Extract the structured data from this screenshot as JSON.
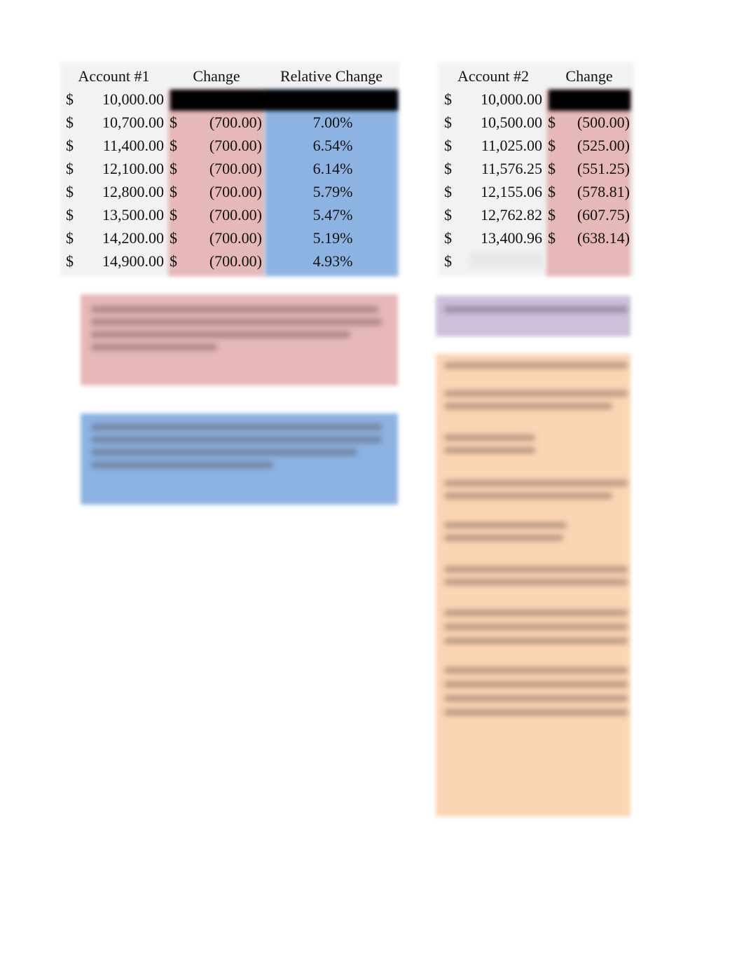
{
  "table1": {
    "headers": [
      "Account #1",
      "Change",
      "Relative Change"
    ],
    "rows": [
      {
        "currency": "$",
        "balance": "10,000.00",
        "change_currency": "",
        "change": "",
        "relative": ""
      },
      {
        "currency": "$",
        "balance": "10,700.00",
        "change_currency": "$",
        "change": "(700.00)",
        "relative": "7.00%"
      },
      {
        "currency": "$",
        "balance": "11,400.00",
        "change_currency": "$",
        "change": "(700.00)",
        "relative": "6.54%"
      },
      {
        "currency": "$",
        "balance": "12,100.00",
        "change_currency": "$",
        "change": "(700.00)",
        "relative": "6.14%"
      },
      {
        "currency": "$",
        "balance": "12,800.00",
        "change_currency": "$",
        "change": "(700.00)",
        "relative": "5.79%"
      },
      {
        "currency": "$",
        "balance": "13,500.00",
        "change_currency": "$",
        "change": "(700.00)",
        "relative": "5.47%"
      },
      {
        "currency": "$",
        "balance": "14,200.00",
        "change_currency": "$",
        "change": "(700.00)",
        "relative": "5.19%"
      },
      {
        "currency": "$",
        "balance": "14,900.00",
        "change_currency": "$",
        "change": "(700.00)",
        "relative": "4.93%"
      }
    ]
  },
  "table2": {
    "headers": [
      "Account #2",
      "Change"
    ],
    "rows": [
      {
        "currency": "$",
        "balance": "10,000.00",
        "change_currency": "",
        "change": ""
      },
      {
        "currency": "$",
        "balance": "10,500.00",
        "change_currency": "$",
        "change": "(500.00)"
      },
      {
        "currency": "$",
        "balance": "11,025.00",
        "change_currency": "$",
        "change": "(525.00)"
      },
      {
        "currency": "$",
        "balance": "11,576.25",
        "change_currency": "$",
        "change": "(551.25)"
      },
      {
        "currency": "$",
        "balance": "12,155.06",
        "change_currency": "$",
        "change": "(578.81)"
      },
      {
        "currency": "$",
        "balance": "12,762.82",
        "change_currency": "$",
        "change": "(607.75)"
      },
      {
        "currency": "$",
        "balance": "13,400.96",
        "change_currency": "$",
        "change": "(638.14)"
      },
      {
        "currency": "$",
        "balance": "",
        "change_currency": "",
        "change": ""
      }
    ]
  },
  "colors": {
    "change_fill": "#e6b8b8",
    "relative_fill": "#8db3e2",
    "note_purple": "#ccc0da",
    "note_orange": "#fcd5b4",
    "redaction": "#000000"
  }
}
